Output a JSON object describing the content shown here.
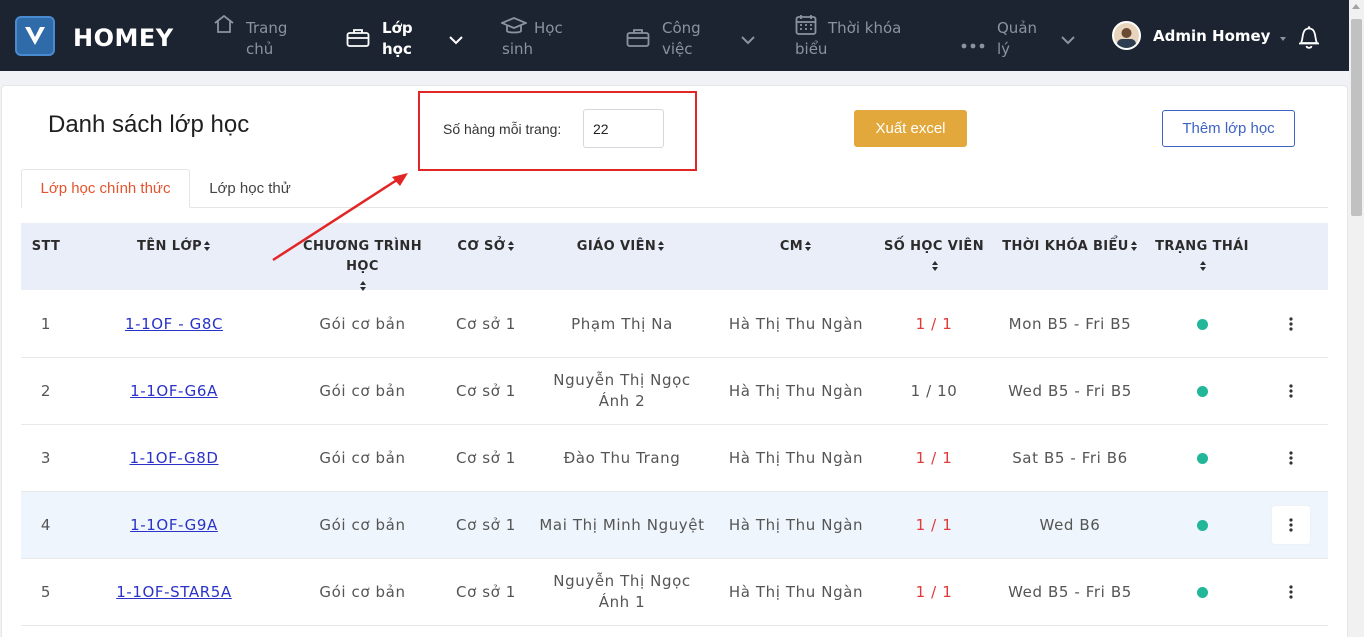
{
  "app": {
    "name": "HOMEY"
  },
  "nav": {
    "items": [
      {
        "label": "Trang chủ",
        "icon": "home-icon"
      },
      {
        "label": "Lớp học",
        "icon": "briefcase-icon"
      },
      {
        "label": "Học sinh",
        "icon": "graduation-cap-icon"
      },
      {
        "label": "Công việc",
        "icon": "briefcase-icon"
      },
      {
        "label": "Thời khóa biểu",
        "icon": "calendar-icon"
      },
      {
        "label": "Quản lý",
        "icon": "more-dots-icon"
      }
    ],
    "user": "Admin Homey"
  },
  "page": {
    "title": "Danh sách lớp học",
    "rows_per_page_label": "Số hàng mỗi trang:",
    "rows_per_page_value": "22",
    "export_button": "Xuất excel",
    "add_button": "Thêm lớp học",
    "tabs": [
      "Lớp học chính thức",
      "Lớp học thử"
    ]
  },
  "table": {
    "headers": {
      "stt": "STT",
      "ten_lop": "TÊN LỚP",
      "chuong_trinh": "CHƯƠNG TRÌNH HỌC",
      "co_so": "CƠ SỞ",
      "giao_vien": "GIÁO VIÊN",
      "cm": "CM",
      "so_hoc_vien": "SỐ HỌC VIÊN",
      "tkb": "THỜI KHÓA BIỂU",
      "trang_thai": "TRẠNG THÁI"
    },
    "rows": [
      {
        "stt": "1",
        "ten_lop": "1-1OF - G8C",
        "chuong_trinh": "Gói cơ bản",
        "co_so": "Cơ sở 1",
        "giao_vien": "Phạm Thị Na",
        "cm": "Hà Thị Thu Ngàn",
        "so_hoc_vien": "1 / 1",
        "tkb": "Mon B5 - Fri B5"
      },
      {
        "stt": "2",
        "ten_lop": "1-1OF-G6A",
        "chuong_trinh": "Gói cơ bản",
        "co_so": "Cơ sở 1",
        "giao_vien": "Nguyễn Thị Ngọc Ánh 2",
        "cm": "Hà Thị Thu Ngàn",
        "so_hoc_vien": "1 / 10",
        "tkb": "Wed B5 - Fri B5"
      },
      {
        "stt": "3",
        "ten_lop": "1-1OF-G8D",
        "chuong_trinh": "Gói cơ bản",
        "co_so": "Cơ sở 1",
        "giao_vien": "Đào Thu Trang",
        "cm": "Hà Thị Thu Ngàn",
        "so_hoc_vien": "1 / 1",
        "tkb": "Sat B5 - Fri B6"
      },
      {
        "stt": "4",
        "ten_lop": "1-1OF-G9A",
        "chuong_trinh": "Gói cơ bản",
        "co_so": "Cơ sở 1",
        "giao_vien": "Mai Thị Minh Nguyệt",
        "cm": "Hà Thị Thu Ngàn",
        "so_hoc_vien": "1 / 1",
        "tkb": "Wed B6"
      },
      {
        "stt": "5",
        "ten_lop": "1-1OF-STAR5A",
        "chuong_trinh": "Gói cơ bản",
        "co_so": "Cơ sở 1",
        "giao_vien": "Nguyễn Thị Ngọc Ánh 1",
        "cm": "Hà Thị Thu Ngàn",
        "so_hoc_vien": "1 / 1",
        "tkb": "Wed B5 - Fri B5"
      }
    ]
  },
  "colors": {
    "nav_bg": "#1b2430",
    "accent_orange": "#e3a83c",
    "tab_active": "#e4542c",
    "link": "#2a32c8",
    "status_active": "#23b79a",
    "annotation_red": "#e22525"
  }
}
